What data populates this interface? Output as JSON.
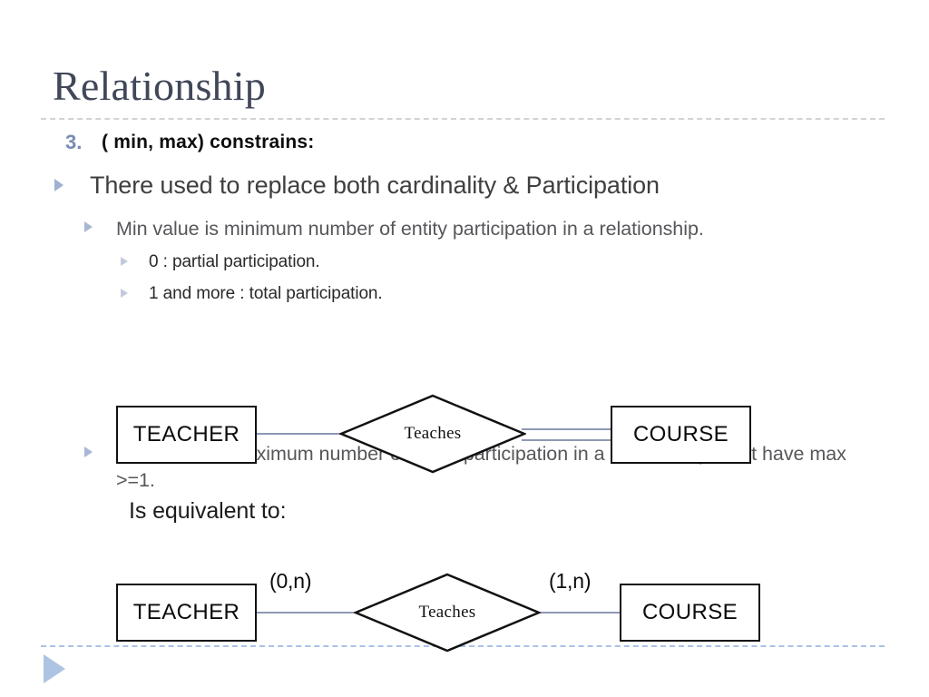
{
  "slide": {
    "title": "Relationship"
  },
  "content": {
    "item_number": "3.",
    "heading": "( min, max) constrains:",
    "level1": "There used to replace both cardinality & Participation",
    "level2_a": "Min value is minimum number of entity participation in  a relationship.",
    "level3_a": "0 : partial participation.",
    "level3_b": "1 and more : total participation.",
    "level2_b": "Max value is maximum number of entity participation in  a relationship must have max >=1.",
    "equivalent_label": "Is equivalent to:"
  },
  "diagram1": {
    "entity_left": "TEACHER",
    "relationship": "Teaches",
    "entity_right": "COURSE",
    "left_line_style": "single",
    "right_line_style": "double"
  },
  "diagram2": {
    "entity_left": "TEACHER",
    "relationship": "Teaches",
    "entity_right": "COURSE",
    "left_cardinality": "(0,n)",
    "right_cardinality": "(1,n)",
    "left_line_style": "single",
    "right_line_style": "single"
  },
  "colors": {
    "title": "#404758",
    "number_accent": "#788bb4",
    "bullet_accent": "#9fb2d1",
    "connector": "#8e99b4",
    "footer_rule": "#a9c2e6",
    "title_rule": "#d2d2d4"
  }
}
